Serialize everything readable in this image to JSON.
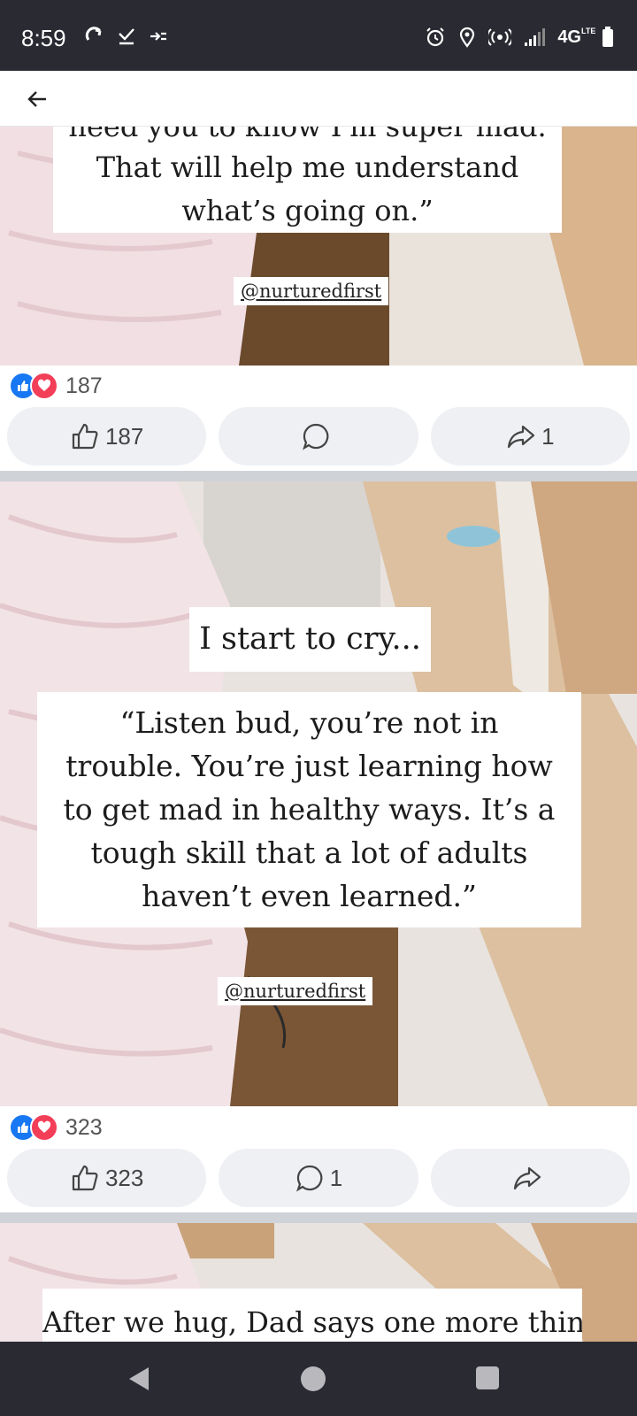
{
  "status_bar": {
    "time": "8:59",
    "network": "4G",
    "network_sub": "LTE",
    "left_icons": [
      "sync-icon",
      "check-icon",
      "data-transfer-icon"
    ],
    "right_icons": [
      "alarm-icon",
      "location-icon",
      "hotspot-icon",
      "signal-icon",
      "battery-icon"
    ]
  },
  "top_bar": {
    "back_icon": "arrow-left-icon"
  },
  "posts": [
    {
      "caption_partial": "need you to know I'm super mad.",
      "caption_lines": [
        "That will help me understand",
        "what’s going on.”"
      ],
      "handle": "@nurturedfirst",
      "reaction_count": "187",
      "like_count": "187",
      "comment_count": "",
      "share_count": "1"
    },
    {
      "caption_title": "I start to cry...",
      "caption_lines": [
        "“Listen bud, you’re not in",
        "trouble. You’re just learning how",
        "to get mad in healthy ways. It’s a",
        "tough skill that a lot of adults",
        "haven’t even learned.”"
      ],
      "handle": "@nurturedfirst",
      "reaction_count": "323",
      "like_count": "323",
      "comment_count": "1",
      "share_count": ""
    },
    {
      "caption_partial": "After we hug, Dad says one more thing"
    }
  ],
  "colors": {
    "status_bar_bg": "#2a2a33",
    "like_blue": "#1877f2",
    "love_red": "#f33e58",
    "button_bg": "#eef0f3"
  }
}
